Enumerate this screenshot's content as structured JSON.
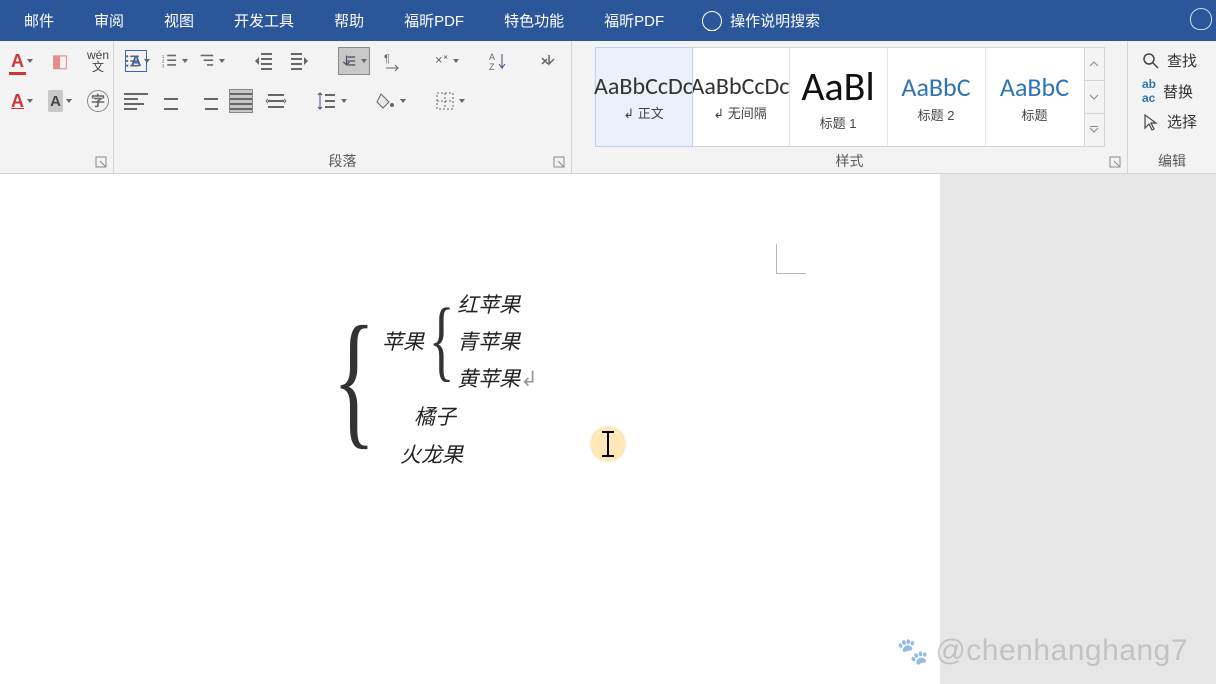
{
  "menubar": {
    "items": [
      "邮件",
      "审阅",
      "视图",
      "开发工具",
      "帮助",
      "福昕PDF",
      "特色功能",
      "福昕PDF"
    ],
    "help_search": "操作说明搜索"
  },
  "ribbon": {
    "paragraph_label": "段落",
    "styles_label": "样式",
    "edit_label": "编辑",
    "styles": [
      {
        "preview": "AaBbCcDc",
        "name": "↲ 正文",
        "active": true,
        "class": ""
      },
      {
        "preview": "AaBbCcDc",
        "name": "↲ 无间隔",
        "active": false,
        "class": ""
      },
      {
        "preview": "AaBl",
        "name": "标题 1",
        "active": false,
        "class": "big"
      },
      {
        "preview": "AaBbC",
        "name": "标题 2",
        "active": false,
        "class": "blue"
      },
      {
        "preview": "AaBbC",
        "name": "标题",
        "active": false,
        "class": "blue"
      }
    ],
    "edit_items": [
      {
        "icon": "search",
        "label": "查找"
      },
      {
        "icon": "replace",
        "label": "替换"
      },
      {
        "icon": "select",
        "label": "选择"
      }
    ]
  },
  "document": {
    "outer_label": "苹果",
    "inner_items": [
      "红苹果",
      "青苹果",
      "黄苹果"
    ],
    "siblings": [
      "橘子",
      "火龙果"
    ]
  },
  "watermark": "@chenhanghang7"
}
